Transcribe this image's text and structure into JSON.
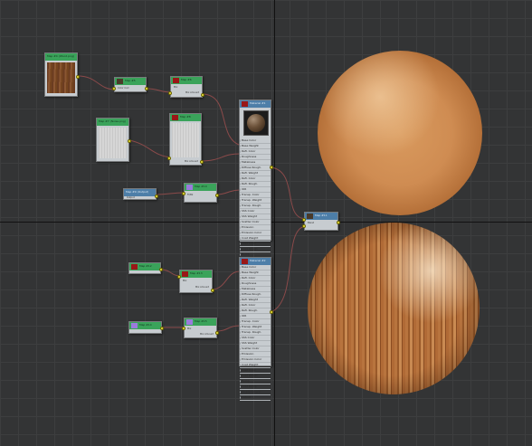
{
  "viewport": {
    "name": "Slate Material Editor view"
  },
  "nodes": {
    "wood_bitmap": {
      "title": "Map #4 (Wood.png)",
      "subtitle": "Bitmap",
      "header_color": "#3aa35a"
    },
    "color_correction_1": {
      "title": "Map #5",
      "subtitle": "Color Corr."
    },
    "mix_1": {
      "title": "Map #6",
      "subtitle": "Mix",
      "row": "Mix Amount"
    },
    "gray_bitmap": {
      "title": "Map #7 (Noise.png)",
      "subtitle": "Bitmap"
    },
    "mix_2": {
      "title": "Map #8",
      "subtitle": "Mix",
      "row": "Mix Amount"
    },
    "output_1": {
      "title": "Map #9 (Output)",
      "subtitle": "Output"
    },
    "falloff_1": {
      "title": "Map #10",
      "subtitle": "Falloff",
      "row": "Fr/Bk"
    },
    "material_top": {
      "title": "Material #1",
      "subtitle": "Physical Material",
      "slots": [
        "Base Color",
        "Base Weight",
        "Refl. Color",
        "Roughness",
        "Metalness",
        "Diffuse Rough.",
        "Refl. Weight",
        "Refl. Color",
        "Refl. Rough.",
        "IOR",
        "Transp. Color",
        "Transp. Weight",
        "Transp. Rough.",
        "SSS Color",
        "SSS Weight",
        "Scatter Color",
        "Emission",
        "Emission Color",
        "Coat Weight",
        "Coat Color",
        "Coat Rough.",
        "Bump",
        "Coat Bump",
        "Displacement",
        "Cutout",
        "Special Map"
      ]
    },
    "blend_out": {
      "title": "Map #11",
      "subtitle": "Blend"
    },
    "color_correction_2": {
      "title": "Map #12",
      "subtitle": "Color Corr."
    },
    "mix_3": {
      "title": "Map #13",
      "subtitle": "Mix",
      "row": "Mix Amount"
    },
    "falloff_2": {
      "title": "Map #14",
      "subtitle": "Falloff"
    },
    "mix_4": {
      "title": "Map #15",
      "subtitle": "Mix",
      "row": "Mix Amount"
    },
    "material_bottom": {
      "title": "Material #2",
      "subtitle": "Physical Material",
      "slots": [
        "Base Color",
        "Base Weight",
        "Refl. Color",
        "Roughness",
        "Metalness",
        "Diffuse Rough.",
        "Refl. Weight",
        "Refl. Color",
        "Refl. Rough.",
        "IOR",
        "Transp. Color",
        "Transp. Weight",
        "Transp. Rough.",
        "SSS Color",
        "SSS Weight",
        "Scatter Color",
        "Emission",
        "Emission Color",
        "Coat Weight",
        "Coat Color",
        "Coat Rough.",
        "Bump",
        "Coat Bump",
        "Displacement",
        "Cutout"
      ]
    }
  },
  "previews": {
    "top_sphere": {
      "name": "Material #1 preview",
      "color": "#cf8c52"
    },
    "bottom_sphere": {
      "name": "Material #2 preview",
      "color": "#b06a36"
    }
  },
  "colors": {
    "background": "#333435",
    "grid": "#3d3e3f",
    "node_body": "#c7ccd0",
    "map_header": "#3aa35a",
    "material_header": "#4d7ea8",
    "wire": "#8b4a4a",
    "port": "#f0e640"
  }
}
